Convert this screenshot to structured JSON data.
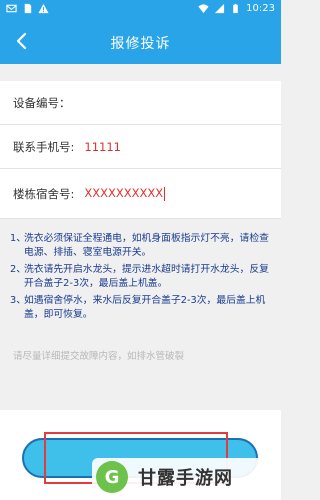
{
  "status_bar": {
    "time": "10:23"
  },
  "header": {
    "title": "报修投诉",
    "back_icon": "chevron-left-icon"
  },
  "form": {
    "device_label": "设备编号：",
    "device_value": "",
    "phone_label": "联系手机号:",
    "phone_value": "11111",
    "dorm_label": "楼栋宿舍号:",
    "dorm_value": "XXXXXXXXXX"
  },
  "notes": [
    {
      "num": "1、",
      "text": "洗衣必须保证全程通电，如机身面板指示灯不亮，请检查电源、排插、寝室电源开关。"
    },
    {
      "num": "2、",
      "text": "洗衣请先开启水龙头，提示进水超时请打开水龙头，反复开合盖子2-3次，最后盖上机盖。"
    },
    {
      "num": "3、",
      "text": "如遇宿舍停水，来水后反复开合盖子2-3次，最后盖上机盖，即可恢复。"
    }
  ],
  "hint": "请尽量详细提交故障内容，如排水管破裂",
  "watermark": {
    "text": "甘露手游网",
    "logo_char": "G"
  },
  "colors": {
    "primary": "#2aa4e8",
    "accent_red": "#e0312f",
    "note_blue": "#1a3b8f"
  }
}
